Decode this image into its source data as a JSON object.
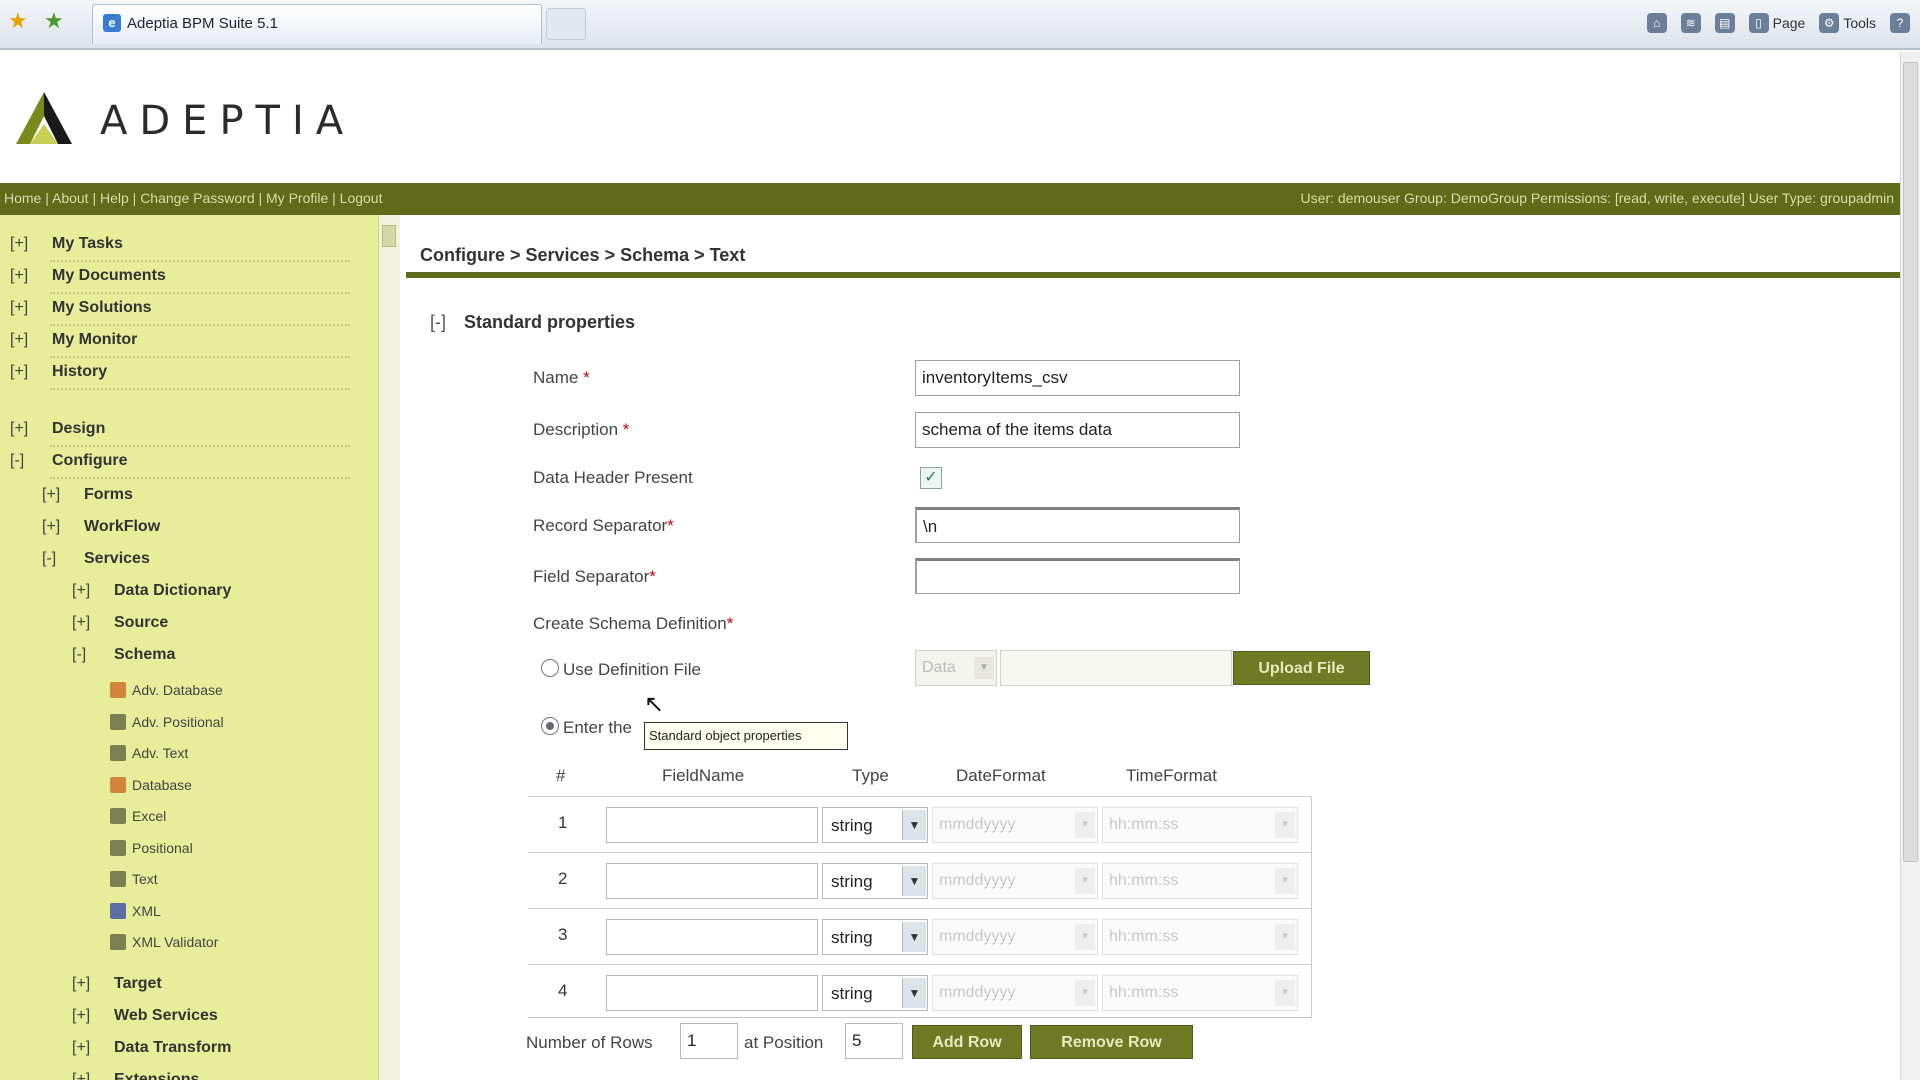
{
  "browser": {
    "tab_title": "Adeptia BPM Suite 5.1",
    "commands": [
      {
        "label": "",
        "icon": "home-icon"
      },
      {
        "label": "",
        "icon": "feeds-icon"
      },
      {
        "label": "",
        "icon": "print-icon"
      },
      {
        "label": "Page",
        "icon": "page-icon"
      },
      {
        "label": "Tools",
        "icon": "tools-icon"
      },
      {
        "label": "",
        "icon": "help-icon"
      }
    ]
  },
  "header": {
    "logo_text": "ADEPTIA",
    "nav_links": "Home | About | Help | Change Password | My Profile | Logout",
    "user_info": "User: demouser Group: DemoGroup Permissions: [read, write, execute] User Type: groupadmin"
  },
  "sidebar": {
    "top_items": [
      {
        "toggle": "[+]",
        "label": "My Tasks"
      },
      {
        "toggle": "[+]",
        "label": "My Documents"
      },
      {
        "toggle": "[+]",
        "label": "My Solutions"
      },
      {
        "toggle": "[+]",
        "label": "My Monitor"
      },
      {
        "toggle": "[+]",
        "label": "History"
      }
    ],
    "design": {
      "toggle": "[+]",
      "label": "Design"
    },
    "configure": {
      "toggle": "[-]",
      "label": "Configure"
    },
    "configure_children": [
      {
        "toggle": "[+]",
        "label": "Forms"
      },
      {
        "toggle": "[+]",
        "label": "WorkFlow"
      },
      {
        "toggle": "[-]",
        "label": "Services"
      }
    ],
    "services_children": [
      {
        "toggle": "[+]",
        "label": "Data Dictionary"
      },
      {
        "toggle": "[+]",
        "label": "Source"
      },
      {
        "toggle": "[-]",
        "label": "Schema"
      }
    ],
    "schema_leaves": [
      {
        "label": "Adv. Database",
        "icon": "orange"
      },
      {
        "label": "Adv. Positional",
        "icon": "olive"
      },
      {
        "label": "Adv. Text",
        "icon": "olive"
      },
      {
        "label": "Database",
        "icon": "orange"
      },
      {
        "label": "Excel",
        "icon": "olive"
      },
      {
        "label": "Positional",
        "icon": "olive"
      },
      {
        "label": "Text",
        "icon": "olive"
      },
      {
        "label": "XML",
        "icon": "blue"
      },
      {
        "label": "XML Validator",
        "icon": "olive"
      }
    ],
    "services_tail": [
      {
        "toggle": "[+]",
        "label": "Target"
      },
      {
        "toggle": "[+]",
        "label": "Web Services"
      },
      {
        "toggle": "[+]",
        "label": "Data Transform"
      },
      {
        "toggle": "[+]",
        "label": "Extensions"
      }
    ]
  },
  "main": {
    "breadcrumb": "Configure > Services > Schema > Text",
    "section_toggle": "[-]",
    "section_title": "Standard properties",
    "fields": {
      "name_label": "Name",
      "name_value": "inventoryItems_csv",
      "description_label": "Description",
      "description_value": "schema of the items data",
      "header_label": "Data Header Present",
      "header_checked": true,
      "record_sep_label": "Record Separator",
      "record_sep_value": "\\n",
      "field_sep_label": "Field Separator",
      "field_sep_value": "",
      "create_def_label": "Create Schema Definition",
      "required_mark": "*"
    },
    "definition": {
      "use_file_label": "Use Definition File",
      "enter_label": "Enter the",
      "data_select": "Data",
      "upload_button": "Upload File",
      "tooltip": "Standard object properties"
    },
    "grid": {
      "headers": [
        "#",
        "FieldName",
        "Type",
        "DateFormat",
        "TimeFormat"
      ],
      "rows": [
        {
          "num": "1",
          "type": "string",
          "date": "mmddyyyy",
          "time": "hh:mm:ss"
        },
        {
          "num": "2",
          "type": "string",
          "date": "mmddyyyy",
          "time": "hh:mm:ss"
        },
        {
          "num": "3",
          "type": "string",
          "date": "mmddyyyy",
          "time": "hh:mm:ss"
        },
        {
          "num": "4",
          "type": "string",
          "date": "mmddyyyy",
          "time": "hh:mm:ss"
        }
      ]
    },
    "footer": {
      "rows_label": "Number of Rows",
      "rows_value": "1",
      "position_label": "at Position",
      "position_value": "5",
      "add_button": "Add Row",
      "remove_button": "Remove Row"
    }
  }
}
